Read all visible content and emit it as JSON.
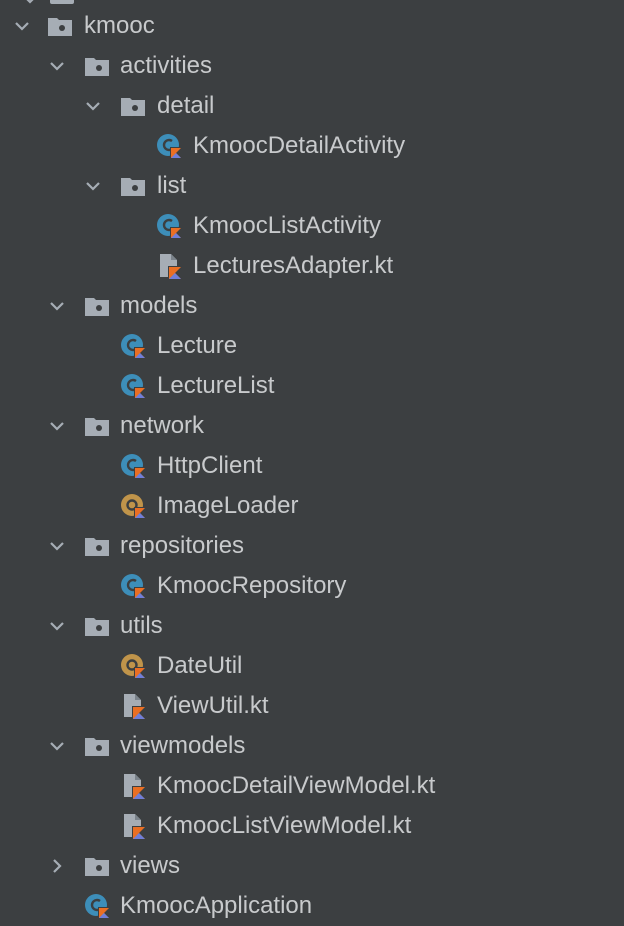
{
  "project_tree": {
    "nodes": [
      {
        "label": "kmooc",
        "kind": "folder",
        "expanded": true
      },
      {
        "label": "activities",
        "kind": "folder",
        "expanded": true
      },
      {
        "label": "detail",
        "kind": "folder",
        "expanded": true
      },
      {
        "label": "KmoocDetailActivity",
        "kind": "class"
      },
      {
        "label": "list",
        "kind": "folder",
        "expanded": true
      },
      {
        "label": "KmoocListActivity",
        "kind": "class"
      },
      {
        "label": "LecturesAdapter.kt",
        "kind": "file"
      },
      {
        "label": "models",
        "kind": "folder",
        "expanded": true
      },
      {
        "label": "Lecture",
        "kind": "class"
      },
      {
        "label": "LectureList",
        "kind": "class"
      },
      {
        "label": "network",
        "kind": "folder",
        "expanded": true
      },
      {
        "label": "HttpClient",
        "kind": "class"
      },
      {
        "label": "ImageLoader",
        "kind": "object"
      },
      {
        "label": "repositories",
        "kind": "folder",
        "expanded": true
      },
      {
        "label": "KmoocRepository",
        "kind": "class"
      },
      {
        "label": "utils",
        "kind": "folder",
        "expanded": true
      },
      {
        "label": "DateUtil",
        "kind": "object"
      },
      {
        "label": "ViewUtil.kt",
        "kind": "file"
      },
      {
        "label": "viewmodels",
        "kind": "folder",
        "expanded": true
      },
      {
        "label": "KmoocDetailViewModel.kt",
        "kind": "file"
      },
      {
        "label": "KmoocListViewModel.kt",
        "kind": "file"
      },
      {
        "label": "views",
        "kind": "folder",
        "expanded": false
      },
      {
        "label": "KmoocApplication",
        "kind": "class"
      }
    ]
  },
  "colors": {
    "background": "#3c3f41",
    "text": "#c8cacc",
    "folder_icon": "#a6adb5",
    "class_icon": "#3d8eb9",
    "object_icon": "#c0944a",
    "kotlin_orange": "#ea6f24",
    "kotlin_blue": "#6f7ed8",
    "file_icon": "#a6adb5"
  },
  "icons": {
    "folder": "folder-icon",
    "class": "kotlin-class-icon",
    "object": "kotlin-object-icon",
    "file": "kotlin-file-icon",
    "expanded": "chevron-down-icon",
    "collapsed": "chevron-right-icon"
  }
}
